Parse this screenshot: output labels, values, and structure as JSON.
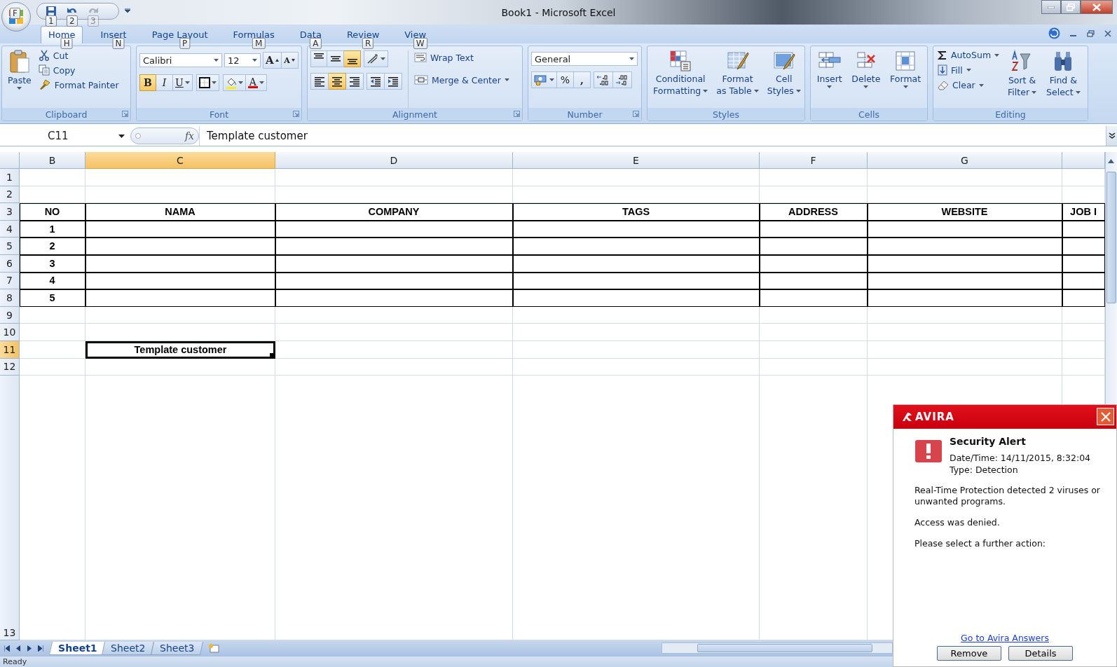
{
  "window": {
    "title": "Book1 - Microsoft Excel"
  },
  "office_button": {
    "keytip": "F"
  },
  "quick_access": [
    {
      "kind": "save",
      "keytip": "1",
      "disabled": false
    },
    {
      "kind": "undo",
      "keytip": "2",
      "disabled": false
    },
    {
      "kind": "redo",
      "keytip": "3",
      "disabled": true
    }
  ],
  "tabs": [
    {
      "label": "Home",
      "keytip": "H",
      "selected": true
    },
    {
      "label": "Insert",
      "keytip": "N",
      "selected": false
    },
    {
      "label": "Page Layout",
      "keytip": "P",
      "selected": false
    },
    {
      "label": "Formulas",
      "keytip": "M",
      "selected": false
    },
    {
      "label": "Data",
      "keytip": "A",
      "selected": false
    },
    {
      "label": "Review",
      "keytip": "R",
      "selected": false
    },
    {
      "label": "View",
      "keytip": "W",
      "selected": false
    }
  ],
  "ribbon": {
    "clipboard": {
      "label": "Clipboard",
      "paste": "Paste",
      "items": [
        {
          "label": "Cut",
          "kind": "cut"
        },
        {
          "label": "Copy",
          "kind": "copy"
        },
        {
          "label": "Format Painter",
          "kind": "painter"
        }
      ]
    },
    "font": {
      "label": "Font",
      "font_name": "Calibri",
      "font_size": "12",
      "size_buttons": [
        {
          "label": "A",
          "kind": "grow"
        },
        {
          "label": "A",
          "kind": "shrink"
        }
      ],
      "styles": [
        {
          "label": "B",
          "on": true
        },
        {
          "label": "I",
          "on": false
        },
        {
          "label": "U",
          "on": false
        }
      ],
      "font_color": "A"
    },
    "alignment": {
      "label": "Alignment",
      "vertical": [
        {
          "kind": "top",
          "selected": false
        },
        {
          "kind": "middle",
          "selected": false
        },
        {
          "kind": "bottom",
          "selected": true
        }
      ],
      "horizontal": [
        {
          "kind": "left",
          "selected": false
        },
        {
          "kind": "center",
          "selected": true
        },
        {
          "kind": "right",
          "selected": false
        }
      ],
      "wrap_text": "Wrap Text",
      "merge": "Merge & Center"
    },
    "number": {
      "label": "Number",
      "format": "General",
      "percent": "%",
      "comma": ","
    },
    "styles": {
      "label": "Styles",
      "buttons": [
        {
          "lines": [
            "Conditional",
            "Formatting"
          ],
          "kind": "conditional"
        },
        {
          "lines": [
            "Format",
            "as Table"
          ],
          "kind": "table"
        },
        {
          "lines": [
            "Cell",
            "Styles"
          ],
          "kind": "cellstyles"
        }
      ]
    },
    "cells": {
      "label": "Cells",
      "buttons": [
        {
          "label": "Insert",
          "kind": "insert"
        },
        {
          "label": "Delete",
          "kind": "delete"
        },
        {
          "label": "Format",
          "kind": "format"
        }
      ]
    },
    "editing": {
      "label": "Editing",
      "small": [
        {
          "label": "AutoSum",
          "kind": "autosum"
        },
        {
          "label": "Fill",
          "kind": "fill"
        },
        {
          "label": "Clear",
          "kind": "clear"
        }
      ],
      "big": [
        {
          "lines": [
            "Sort &",
            "Filter"
          ],
          "kind": "sort"
        },
        {
          "lines": [
            "Find &",
            "Select"
          ],
          "kind": "find"
        }
      ]
    }
  },
  "formula_bar": {
    "name_box": "C11",
    "function_label": "fx",
    "formula": "Template customer"
  },
  "sheet": {
    "columns": [
      {
        "label": "B",
        "selected": false
      },
      {
        "label": "C",
        "selected": true
      },
      {
        "label": "D",
        "selected": false
      },
      {
        "label": "E",
        "selected": false
      },
      {
        "label": "F",
        "selected": false
      },
      {
        "label": "G",
        "selected": false
      }
    ],
    "rows": [
      {
        "label": "1",
        "selected": false,
        "bordered": false
      },
      {
        "label": "2",
        "selected": false,
        "bordered": false
      },
      {
        "label": "3",
        "selected": false,
        "bordered": true,
        "cells": [
          {
            "text": "NO",
            "selected": false
          },
          {
            "text": "NAMA",
            "selected": false
          },
          {
            "text": "COMPANY",
            "selected": false
          },
          {
            "text": "TAGS",
            "selected": false
          },
          {
            "text": "ADDRESS",
            "selected": false
          },
          {
            "text": "WEBSITE",
            "selected": false
          },
          {
            "text": "JOB I",
            "selected": false
          }
        ]
      },
      {
        "label": "4",
        "selected": false,
        "bordered": true,
        "cells": [
          {
            "text": "1",
            "selected": false
          }
        ]
      },
      {
        "label": "5",
        "selected": false,
        "bordered": true,
        "cells": [
          {
            "text": "2",
            "selected": false
          }
        ]
      },
      {
        "label": "6",
        "selected": false,
        "bordered": true,
        "cells": [
          {
            "text": "3",
            "selected": false
          }
        ]
      },
      {
        "label": "7",
        "selected": false,
        "bordered": true,
        "cells": [
          {
            "text": "4",
            "selected": false
          }
        ]
      },
      {
        "label": "8",
        "selected": false,
        "bordered": true,
        "cells": [
          {
            "text": "5",
            "selected": false
          }
        ]
      },
      {
        "label": "9",
        "selected": false,
        "bordered": false
      },
      {
        "label": "10",
        "selected": false,
        "bordered": false
      },
      {
        "label": "11",
        "selected": true,
        "bordered": false,
        "cells": [
          null,
          {
            "text": "Template customer",
            "selected": true
          }
        ]
      },
      {
        "label": "12",
        "selected": false,
        "bordered": false
      },
      {
        "label": "13",
        "selected": false,
        "bordered": false
      }
    ]
  },
  "sheet_tabs": [
    {
      "label": "Sheet1",
      "selected": true
    },
    {
      "label": "Sheet2",
      "selected": false
    },
    {
      "label": "Sheet3",
      "selected": false
    }
  ],
  "status_bar": {
    "text": "Ready"
  },
  "alert": {
    "brand": "AVIRA",
    "title": "Security Alert",
    "date_time": "Date/Time: 14/11/2015, 8:32:04",
    "type": "Type: Detection",
    "paragraphs": [
      "Real-Time Protection detected 2 viruses or unwanted programs.",
      "Access was denied.",
      "Please select a further action:"
    ],
    "link": "Go to Avira Answers",
    "buttons": [
      "Remove",
      "Details"
    ]
  }
}
